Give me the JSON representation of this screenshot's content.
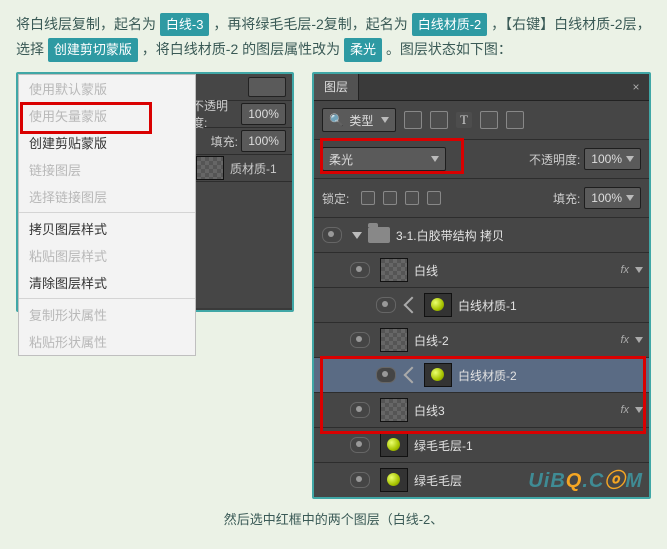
{
  "instr": {
    "p1a": "将白线层复制，起名为",
    "t1": "白线-3",
    "p1b": "，再将绿毛毛层-2复制，起名为",
    "t2": "白线材质-2",
    "p1c": "，【右键】白线材质-2层，",
    "p2a": "选择",
    "t3": "创建剪切蒙版",
    "p2b": "，将白线材质-2 的图层属性改为",
    "t4": "柔光",
    "p2c": "。图层状态如下图：",
    "footer": "然后选中红框中的两个图层（白线-2、"
  },
  "ctx": {
    "i0": "使用默认蒙版",
    "i1": "使用矢量蒙版",
    "i2": "创建剪贴蒙版",
    "i3": "链接图层",
    "i4": "选择链接图层",
    "i5": "拷贝图层样式",
    "i6": "粘贴图层样式",
    "i7": "清除图层样式",
    "i8": "复制形状属性",
    "i9": "粘贴形状属性"
  },
  "leftpanel": {
    "opacity_lbl": "不透明度:",
    "opacity_val": "100%",
    "fill_lbl": "填充:",
    "fill_val": "100%",
    "layer": "质材质-1"
  },
  "panel": {
    "tab": "图层",
    "filter": "类型",
    "blend": "柔光",
    "opacity_lbl": "不透明度:",
    "opacity_val": "100%",
    "lock_lbl": "锁定:",
    "fill_lbl": "填充:",
    "fill_val": "100%",
    "group": "3-1.白胶带结构 拷贝",
    "l1": "白线",
    "l2": "白线材质-1",
    "l3": "白线-2",
    "l4": "白线材质-2",
    "l5": "白线3",
    "l6": "绿毛毛层-1",
    "l7": "绿毛毛层",
    "fx": "fx"
  },
  "watermark": {
    "a": "UiB",
    "b": "Q",
    "c": ".C",
    "d": "ⓞ",
    "e": "M"
  }
}
